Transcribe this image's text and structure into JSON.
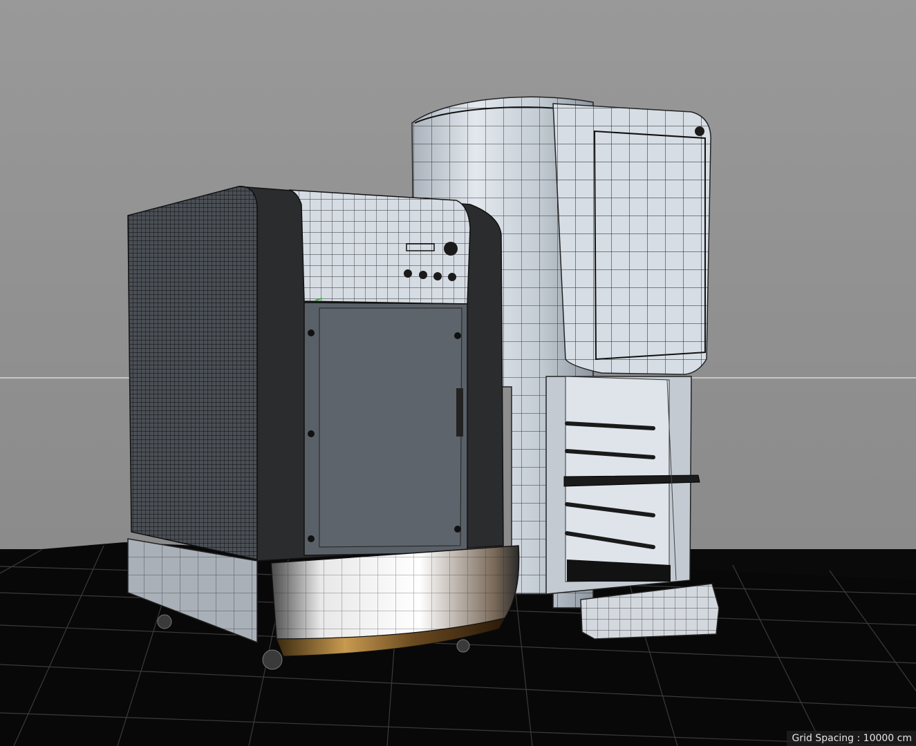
{
  "viewport": {
    "grid_spacing_label": "Grid Spacing : 10000 cm"
  },
  "colors": {
    "background": "#909090",
    "floor": "#090909",
    "grid_lines": "#3a3a3a",
    "horizon": "#d8d8d8",
    "mesh_light": "#c9d1d9",
    "mesh_dark": "#2f2f2f",
    "wire": "#111111"
  },
  "icons": [
    "gizmo-axis-icon"
  ]
}
